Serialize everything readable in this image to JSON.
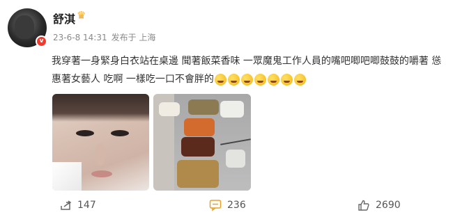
{
  "author": {
    "name": "舒淇",
    "verified_icon": "verified-v-badge",
    "vip_icon": "crown-icon"
  },
  "meta": {
    "timestamp": "23-6-8 14:31",
    "source": "发布于 上海"
  },
  "post": {
    "text": "我穿著一身緊身白衣站在桌邊 聞著飯菜香味 一眾魔鬼工作人員的嘴吧唧吧唧鼓鼓的嚼著 慫惠著女藝人 吃啊 一樣吃一口不會胖的",
    "emojis": [
      "laugh-cry-emoji",
      "laugh-cry-emoji",
      "laugh-cry-emoji",
      "laugh-cry-emoji",
      "laugh-cry-emoji",
      "laugh-cry-emoji",
      "laugh-cry-emoji"
    ]
  },
  "images": [
    {
      "name": "selfie-photo"
    },
    {
      "name": "food-tray-photo"
    }
  ],
  "actions": {
    "repost_count": "147",
    "comment_count": "236",
    "like_count": "2690"
  },
  "colors": {
    "accent": "#f0a92a",
    "verified": "#f23b2f",
    "meta_text": "#8a8a8a"
  }
}
